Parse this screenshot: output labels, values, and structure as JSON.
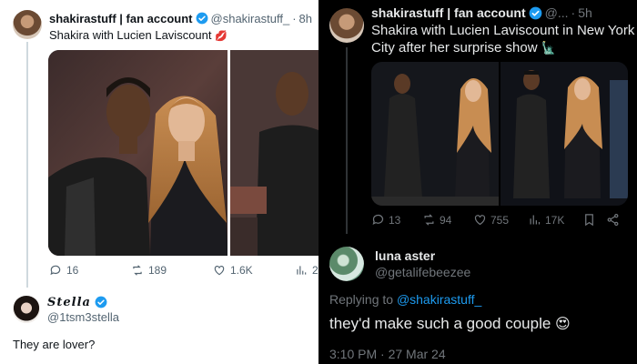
{
  "left_post": {
    "author_name": "shakirastuff | fan account",
    "author_handle": "@shakirastuff_",
    "separator": "·",
    "time": "8h",
    "text": "Shakira with Lucien Laviscount",
    "text_emoji": "💋",
    "actions": {
      "replies": "16",
      "reposts": "189",
      "likes": "1.6K",
      "views": "2"
    }
  },
  "left_reply": {
    "author_name": "Stella",
    "author_handle": "@1tsm3stella",
    "text": "They are lover?"
  },
  "right_post": {
    "author_name": "shakirastuff | fan account",
    "author_handle": "@...",
    "separator": "·",
    "time": "5h",
    "text": "Shakira with Lucien Laviscount in New York City after her surprise show",
    "text_emoji": "🗽",
    "actions": {
      "replies": "13",
      "reposts": "94",
      "likes": "755",
      "views": "17K"
    }
  },
  "right_reply": {
    "author_name": "luna aster",
    "author_handle": "@getalifebeezee",
    "replying_prefix": "Replying to",
    "replying_to": "@shakirastuff_",
    "text": "they'd make such a good couple",
    "text_emoji": "😍",
    "timestamp": "3:10 PM · 27 Mar 24"
  },
  "colors": {
    "verified_blue": "#1d9bf0",
    "light_bg": "#ffffff",
    "dark_bg": "#000000",
    "light_text": "#0f1419",
    "light_muted": "#536471",
    "dark_text": "#e7e9ea",
    "dark_muted": "#71767b"
  },
  "icons": [
    "reply-icon",
    "repost-icon",
    "like-icon",
    "views-icon",
    "bookmark-icon",
    "share-icon",
    "verified-badge-icon"
  ]
}
